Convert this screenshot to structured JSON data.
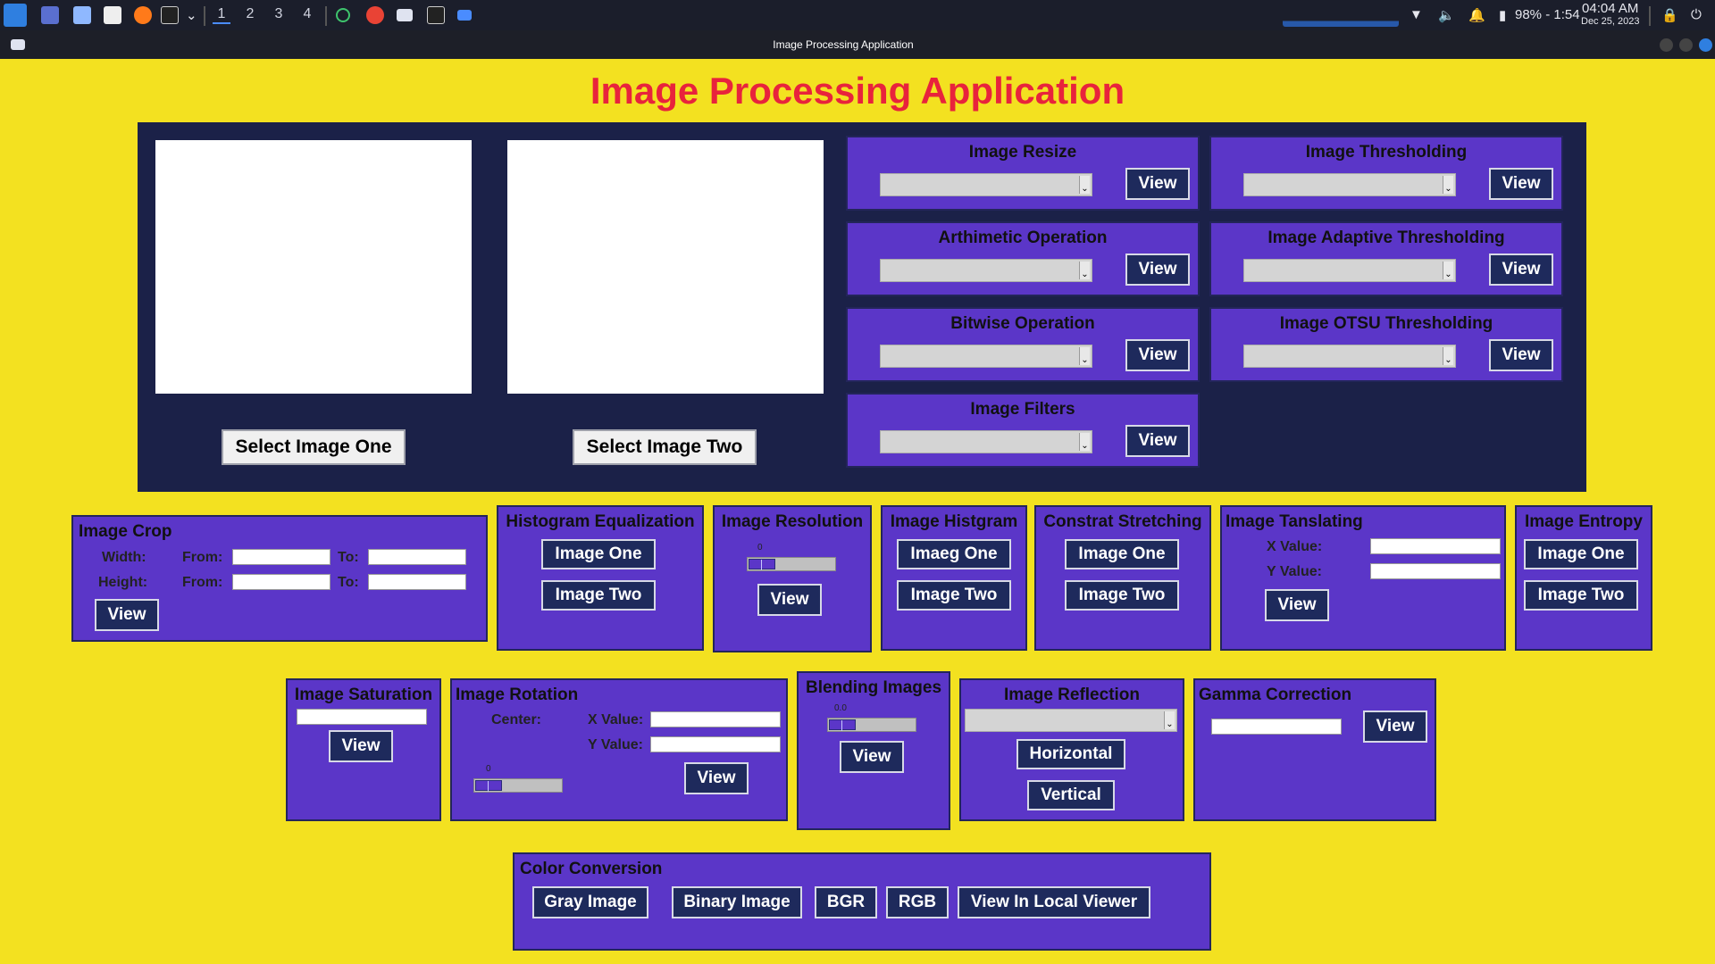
{
  "taskbar": {
    "workspaces": [
      "1",
      "2",
      "3",
      "4"
    ],
    "battery": "98% - 1:54",
    "time": "04:04 AM",
    "date": "Dec 25, 2023"
  },
  "window": {
    "title": "Image Processing Application"
  },
  "app": {
    "title": "Image Processing Application",
    "select_one": "Select Image One",
    "select_two": "Select Image Two"
  },
  "view_label": "View",
  "top_panels": {
    "resize": "Image Resize",
    "arith": "Arthimetic Operation",
    "bitwise": "Bitwise Operation",
    "filters": "Image Filters",
    "threshold": "Image Thresholding",
    "adaptive": "Image Adaptive Thresholding",
    "otsu": "Image OTSU Thresholding"
  },
  "crop": {
    "title": "Image Crop",
    "width": "Width:",
    "height": "Height:",
    "from": "From:",
    "to": "To:"
  },
  "hist_eq": {
    "title": "Histogram Equalization",
    "one": "Image One",
    "two": "Image Two"
  },
  "resolution": {
    "title": "Image Resolution",
    "value": "0"
  },
  "histgram": {
    "title": "Image Histgram",
    "one": "Imaeg One",
    "two": "Image Two"
  },
  "contrast": {
    "title": "Constrat Stretching",
    "one": "Image One",
    "two": "Image Two"
  },
  "translate": {
    "title": "Image Tanslating",
    "x": "X Value:",
    "y": "Y Value:"
  },
  "entropy": {
    "title": "Image Entropy",
    "one": "Image One",
    "two": "Image Two"
  },
  "saturation": {
    "title": "Image Saturation"
  },
  "rotation": {
    "title": "Image Rotation",
    "center": "Center:",
    "x": "X Value:",
    "y": "Y Value:",
    "value": "0"
  },
  "blending": {
    "title": "Blending Images",
    "value": "0.0"
  },
  "reflection": {
    "title": "Image Reflection",
    "horizontal": "Horizontal",
    "vertical": "Vertical"
  },
  "gamma": {
    "title": "Gamma Correction"
  },
  "color": {
    "title": "Color Conversion",
    "gray": "Gray Image",
    "binary": "Binary Image",
    "bgr": "BGR",
    "rgb": "RGB",
    "local": "View In Local Viewer"
  },
  "colors": {
    "background": "#f3e120",
    "title": "#e8233c",
    "navy": "#1b2148",
    "panel": "#5b36c8",
    "button": "#1e2a5c"
  }
}
